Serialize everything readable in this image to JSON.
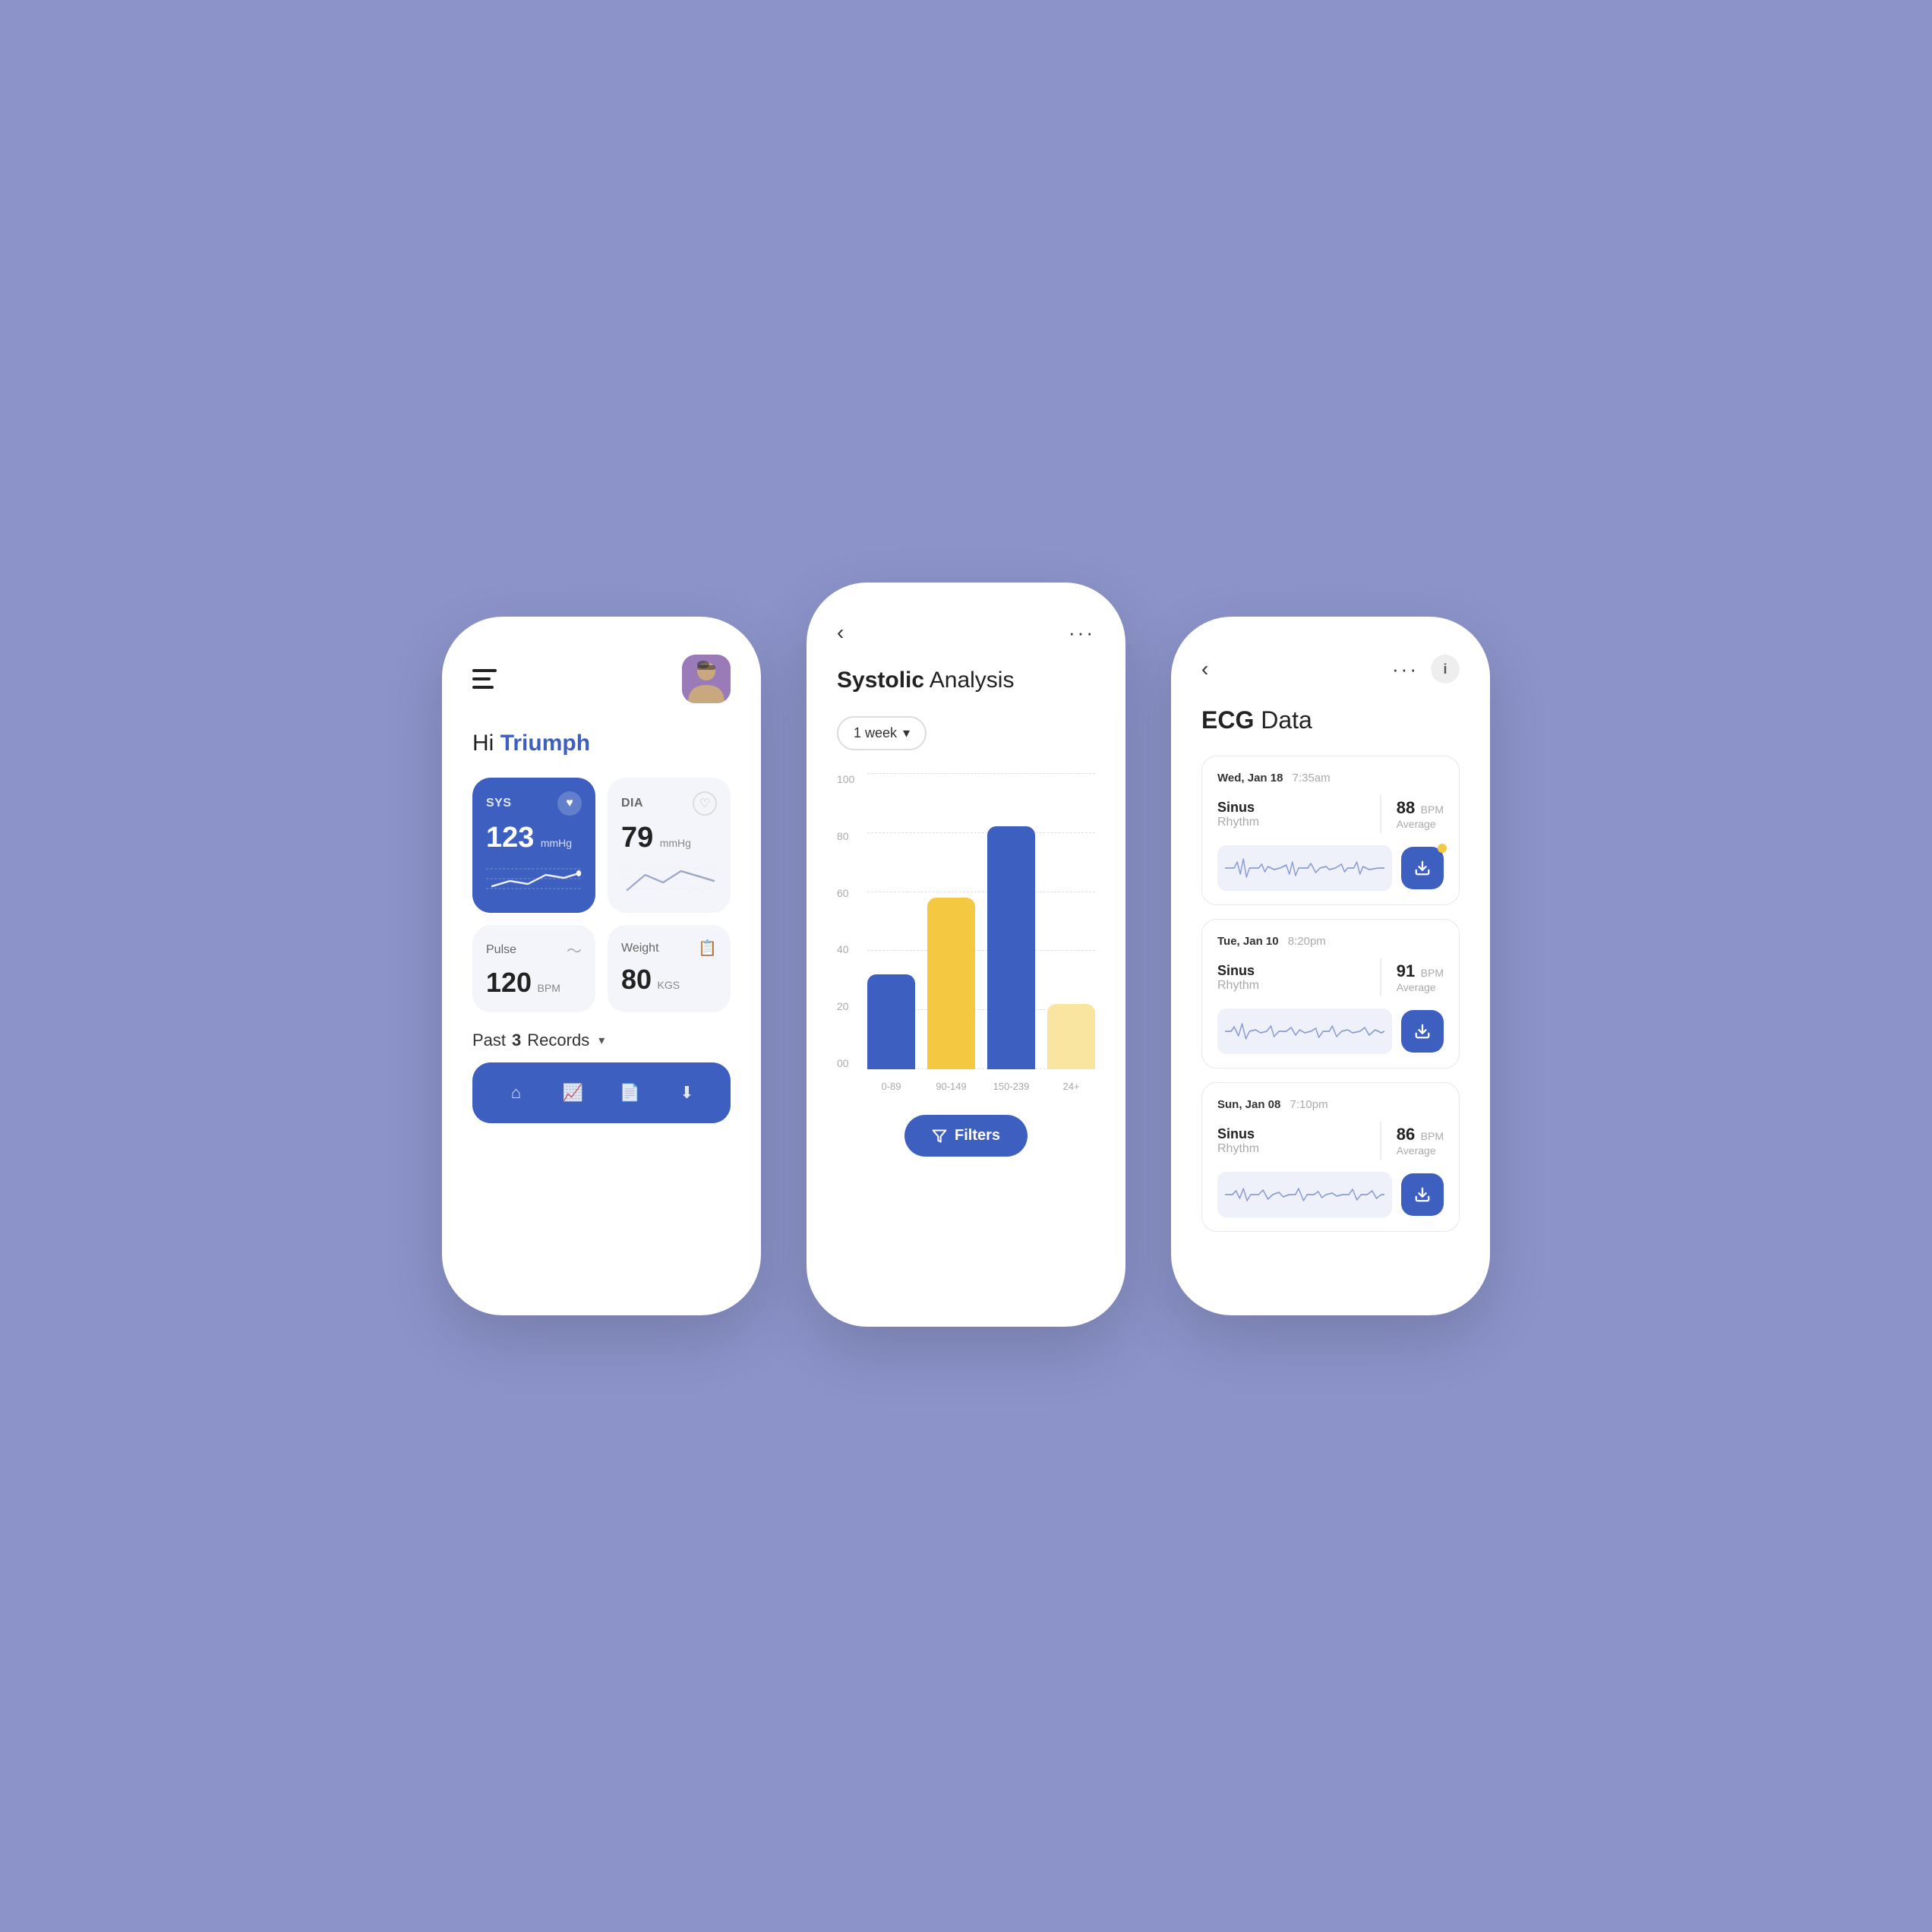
{
  "background": "#8B93C9",
  "accent": "#3D5FC0",
  "phone1": {
    "greeting": "Hi",
    "name": "Triumph",
    "sys_label": "SYS",
    "sys_value": "123",
    "sys_unit": "mmHg",
    "dia_label": "DIA",
    "dia_value": "79",
    "dia_unit": "mmHg",
    "pulse_label": "Pulse",
    "pulse_value": "120",
    "pulse_unit": "BPM",
    "weight_label": "Weight",
    "weight_value": "80",
    "weight_unit": "KGS",
    "past_records_pre": "Past",
    "past_records_num": "3",
    "past_records_post": "Records",
    "nav": [
      "home",
      "stats",
      "document",
      "download"
    ]
  },
  "phone2": {
    "title_bold": "Systolic",
    "title_rest": " Analysis",
    "dropdown_label": "1 week",
    "chart": {
      "y_labels": [
        "00",
        "20",
        "40",
        "60",
        "80",
        "100"
      ],
      "bars": [
        {
          "label": "0-89",
          "height_pct": 32,
          "color": "bar-blue"
        },
        {
          "label": "90-149",
          "height_pct": 58,
          "color": "bar-yellow"
        },
        {
          "label": "150-239",
          "height_pct": 82,
          "color": "bar-blue"
        },
        {
          "label": "24+",
          "height_pct": 22,
          "color": "bar-yellow-light"
        }
      ]
    },
    "filters_label": "Filters"
  },
  "phone3": {
    "title_bold": "ECG",
    "title_rest": " Data",
    "records": [
      {
        "date": "Wed, Jan 18",
        "time": "7:35am",
        "rhythm_label": "Sinus",
        "rhythm_sub": "Rhythm",
        "bpm": "88",
        "bpm_label": "Average"
      },
      {
        "date": "Tue, Jan 10",
        "time": "8:20pm",
        "rhythm_label": "Sinus",
        "rhythm_sub": "Rhythm",
        "bpm": "91",
        "bpm_label": "Average"
      },
      {
        "date": "Sun, Jan 08",
        "time": "7:10pm",
        "rhythm_label": "Sinus",
        "rhythm_sub": "Rhythm",
        "bpm": "86",
        "bpm_label": "Average"
      }
    ]
  }
}
